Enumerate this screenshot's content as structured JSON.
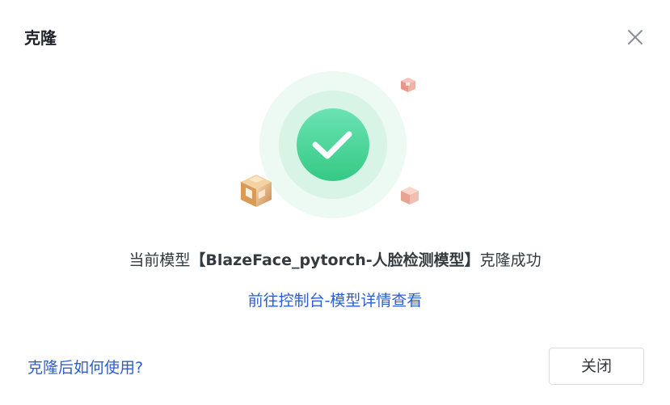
{
  "dialog": {
    "title": "克隆",
    "close_icon": "close-icon",
    "success_icon": "check-circle-icon"
  },
  "message": {
    "prefix": "当前模型",
    "model_name": "【BlazeFace_pytorch-人脸检测模型】",
    "suffix": "克隆成功"
  },
  "links": {
    "console": "前往控制台-模型详情查看",
    "help": "克隆后如何使用?"
  },
  "buttons": {
    "close": "关闭"
  },
  "colors": {
    "success_green": "#3fd195",
    "link_blue": "#2d5ecf"
  }
}
